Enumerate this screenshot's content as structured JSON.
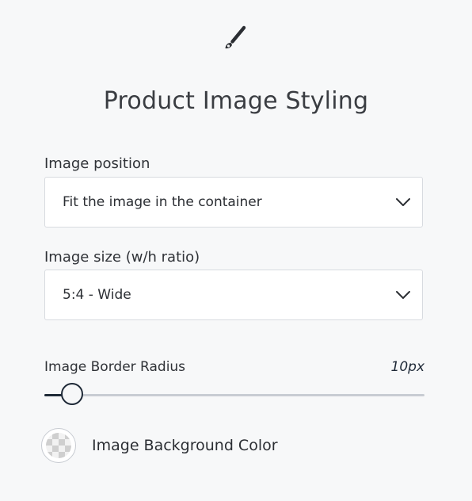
{
  "header": {
    "icon": "paintbrush-icon",
    "title": "Product Image Styling"
  },
  "image_position": {
    "label": "Image position",
    "value": "Fit the image in the container"
  },
  "image_size": {
    "label": "Image size (w/h ratio)",
    "value": "5:4 - Wide"
  },
  "border_radius": {
    "label": "Image Border Radius",
    "value_text": "10px",
    "fraction": 0.073
  },
  "background_color": {
    "label": "Image Background Color",
    "swatch": "transparent-checker"
  },
  "colors": {
    "background": "#f7f8f9",
    "accent": "#1f2a38",
    "track": "#c8ccd3"
  }
}
